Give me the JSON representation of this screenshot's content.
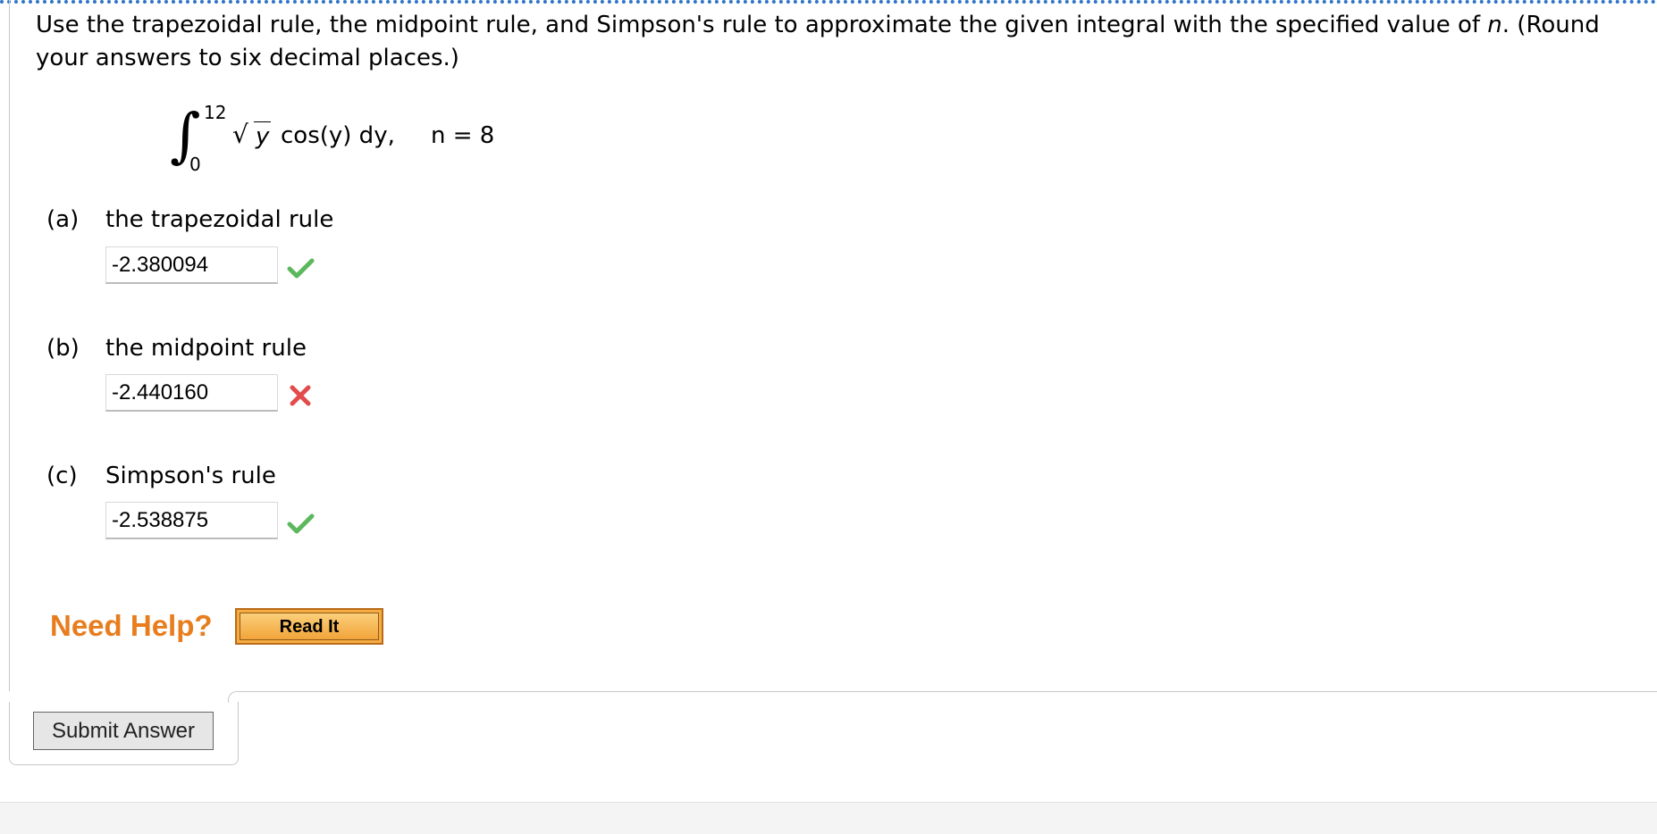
{
  "question": {
    "text_before_n": "Use the trapezoidal rule, the midpoint rule, and Simpson's rule to approximate the given integral with the specified value of ",
    "n_var": "n",
    "text_after_n": ". (Round your answers to six decimal places.)"
  },
  "integral": {
    "upper_limit": "12",
    "lower_limit": "0",
    "radicand": "y",
    "integrand_rest": "cos(y) dy,",
    "n_label": "n = 8"
  },
  "parts": [
    {
      "letter": "(a)",
      "label": "the trapezoidal rule",
      "value": "-2.380094",
      "status": "correct"
    },
    {
      "letter": "(b)",
      "label": "the midpoint rule",
      "value": "-2.440160",
      "status": "incorrect"
    },
    {
      "letter": "(c)",
      "label": "Simpson's rule",
      "value": "-2.538875",
      "status": "correct"
    }
  ],
  "help": {
    "need_help_label": "Need Help?",
    "read_it_label": "Read It"
  },
  "submit_label": "Submit Answer",
  "colors": {
    "correct": "#5cb85c",
    "incorrect": "#e24c4c",
    "need_help": "#e87d1e",
    "dotted_border": "#2f74c9"
  }
}
